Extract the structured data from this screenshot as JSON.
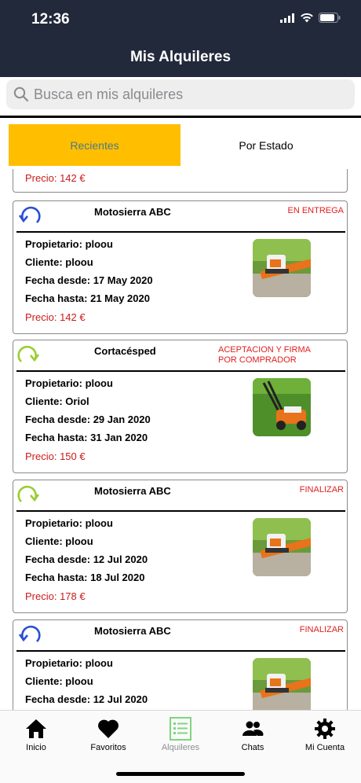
{
  "status_bar": {
    "time": "12:36"
  },
  "header": {
    "title": "Mis Alquileres"
  },
  "search": {
    "placeholder": "Busca en mis alquileres"
  },
  "segments": {
    "active": "Recientes",
    "inactive": "Por Estado"
  },
  "labels": {
    "owner": "Propietario:",
    "client": "Cliente:",
    "from": "Fecha desde:",
    "to": "Fecha hasta:",
    "price": "Precio:"
  },
  "partial_card": {
    "price": "Precio: 142 €"
  },
  "cards": [
    {
      "name": "Motosierra ABC",
      "status": "EN ENTREGA",
      "owner": "Propietario: ploou",
      "client": "Cliente: ploou",
      "from": "Fecha desde: 17 May 2020",
      "to": "Fecha hasta: 21 May 2020",
      "price": "Precio: 142 €",
      "icon": "rotate-ccw-icon",
      "icon_color": "#2a4fd6",
      "thumb": "chainsaw"
    },
    {
      "name": "Cortacésped",
      "status": "ACEPTACION Y FIRMA\nPOR COMPRADOR",
      "owner": "Propietario: ploou",
      "client": "Cliente: Oriol",
      "from": "Fecha desde: 29 Jan 2020",
      "to": "Fecha hasta: 31 Jan 2020",
      "price": "Precio: 150 €",
      "icon": "rotate-cw-icon",
      "icon_color": "#9acd32",
      "thumb": "lawnmower"
    },
    {
      "name": "Motosierra ABC",
      "status": "FINALIZAR",
      "owner": "Propietario: ploou",
      "client": "Cliente: ploou",
      "from": "Fecha desde: 12 Jul 2020",
      "to": "Fecha hasta: 18 Jul 2020",
      "price": "Precio: 178 €",
      "icon": "rotate-cw-icon",
      "icon_color": "#9acd32",
      "thumb": "chainsaw"
    },
    {
      "name": "Motosierra ABC",
      "status": "FINALIZAR",
      "owner": "Propietario: ploou",
      "client": "Cliente: ploou",
      "from": "Fecha desde: 12 Jul 2020",
      "to": "",
      "price": "",
      "icon": "rotate-ccw-icon",
      "icon_color": "#2a4fd6",
      "thumb": "chainsaw"
    }
  ],
  "tabbar": [
    {
      "label": "Inicio",
      "icon": "home-icon"
    },
    {
      "label": "Favoritos",
      "icon": "heart-icon"
    },
    {
      "label": "Alquileres",
      "icon": "list-icon",
      "active": true
    },
    {
      "label": "Chats",
      "icon": "people-icon"
    },
    {
      "label": "Mi Cuenta",
      "icon": "gear-icon"
    }
  ],
  "colors": {
    "header_bg": "#22293a",
    "segment_active": "#ffbe00",
    "status_red": "#e02020",
    "price_red": "#cc1a1a",
    "tab_active_green": "#7ed67e"
  }
}
